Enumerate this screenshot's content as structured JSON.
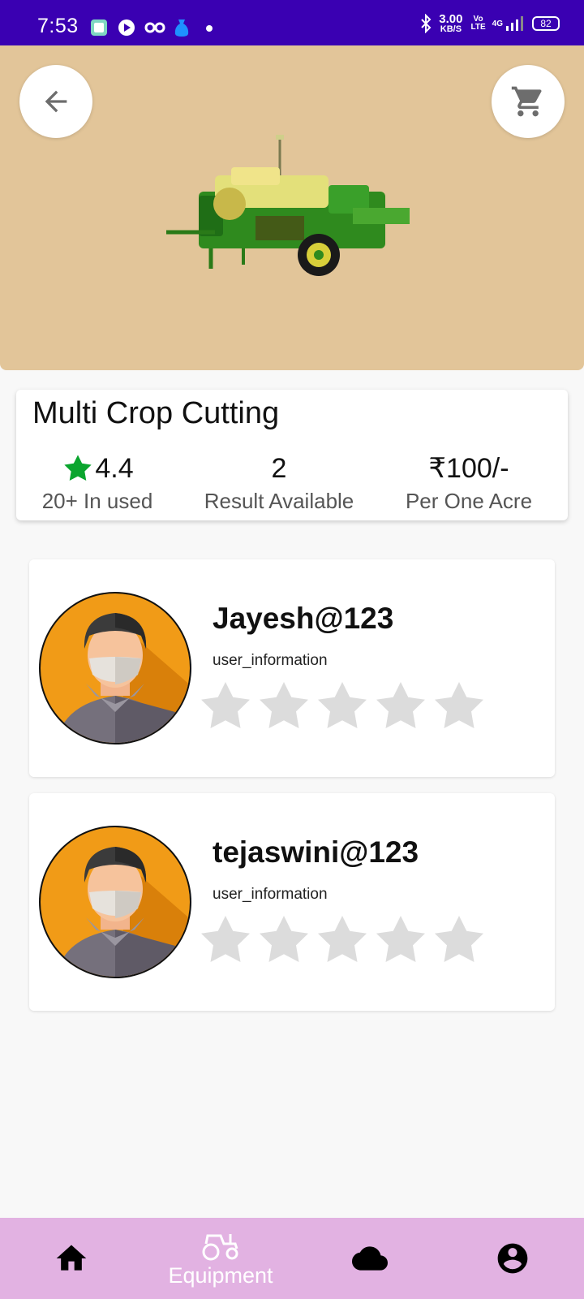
{
  "status_bar": {
    "time": "7:53",
    "net_speed_value": "3.00",
    "net_speed_unit": "KB/S",
    "volte_top": "Vo",
    "volte_bottom": "LTE",
    "network": "4G",
    "battery": "82"
  },
  "header": {
    "back_icon": "arrow-left-icon",
    "cart_icon": "cart-icon",
    "image_bg": "#e2c599"
  },
  "product": {
    "title": "Multi Crop Cutting",
    "rating_value": "4.4",
    "rating_label": "20+ In used",
    "results_value": "2",
    "results_label": "Result Available",
    "price_value": "₹100/-",
    "price_label": "Per One Acre",
    "rating_star_color": "#0aa52e"
  },
  "users": [
    {
      "name": "Jayesh@123",
      "subtitle": "user_information",
      "stars": 0
    },
    {
      "name": "tejaswini@123",
      "subtitle": "user_information",
      "stars": 0
    }
  ],
  "bottom_nav": {
    "items": [
      {
        "icon": "home-icon",
        "label": ""
      },
      {
        "icon": "tractor-icon",
        "label": "Equipment",
        "active": true
      },
      {
        "icon": "cloud-icon",
        "label": ""
      },
      {
        "icon": "account-icon",
        "label": ""
      }
    ],
    "background": "#e2b2e2"
  },
  "colors": {
    "status_bar": "#3a00b2",
    "star_empty": "#dcdcdc"
  }
}
